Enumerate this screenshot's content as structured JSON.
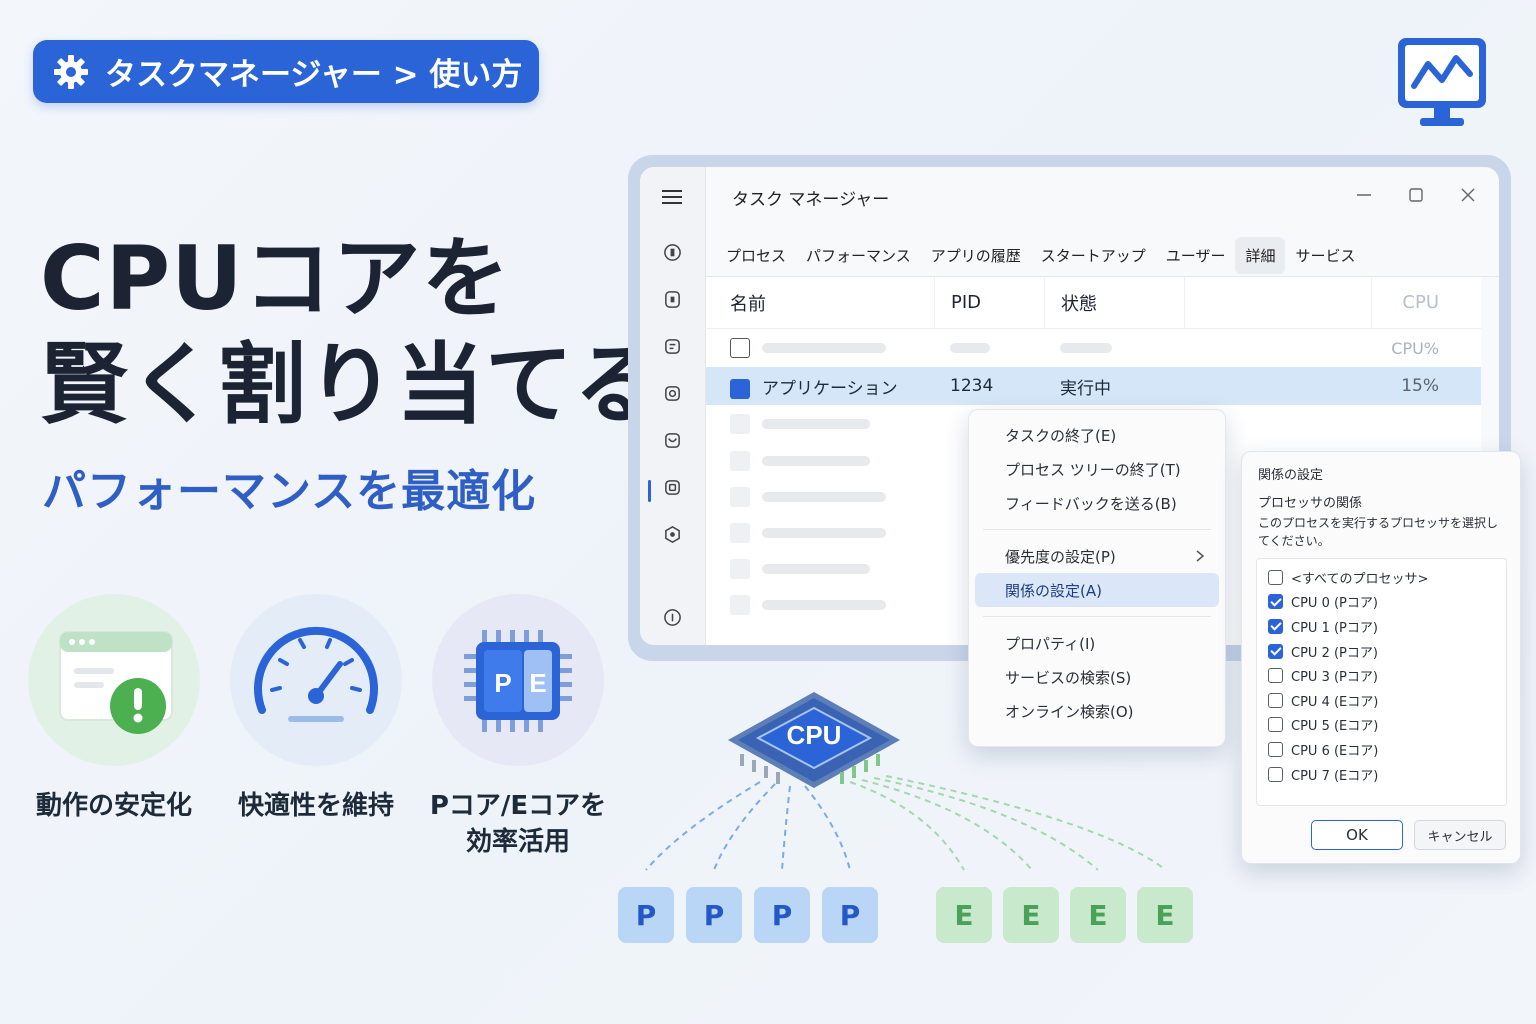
{
  "breadcrumb": {
    "text": "タスクマネージャー > 使い方",
    "icon": "gear-icon"
  },
  "logo": {
    "icon": "monitor-activity-icon",
    "color": "#2a64d6"
  },
  "hero": {
    "title_line1": "CPUコアを",
    "title_line2": "賢く割り当てる",
    "subtitle": "パフォーマンスを最適化"
  },
  "features": [
    {
      "icon": "warning-window-icon",
      "label": "動作の安定化",
      "label2": ""
    },
    {
      "icon": "speedometer-icon",
      "label": "快適性を維持",
      "label2": ""
    },
    {
      "icon": "pe-core-chip-icon",
      "label": "Pコア/Eコアを",
      "label2": "効率活用"
    }
  ],
  "task_manager": {
    "title": "タスク マネージャー",
    "tabs": [
      "プロセス",
      "パフォーマンス",
      "アプリの履歴",
      "スタートアップ",
      "ユーザー",
      "詳細",
      "サービス"
    ],
    "active_tab": "詳細",
    "columns": {
      "name": "名前",
      "pid": "PID",
      "status": "状態",
      "cpu": "CPU"
    },
    "row_top_cpu": "CPU%",
    "selected_row": {
      "name": "アプリケーション",
      "pid": "1234",
      "status": "実行中",
      "cpu": "15%"
    }
  },
  "context_menu": {
    "items": [
      "タスクの終了(E)",
      "プロセス ツリーの終了(T)",
      "フィードバックを送る(B)",
      "優先度の設定(P)",
      "関係の設定(A)",
      "プロパティ(I)",
      "サービスの検索(S)",
      "オンライン検索(O)"
    ],
    "highlighted": "関係の設定(A)"
  },
  "affinity_dialog": {
    "title": "関係の設定",
    "subtitle": "プロセッサの関係",
    "description": "このプロセスを実行するプロセッサを選択してください。",
    "options": [
      {
        "label": "<すべてのプロセッサ>",
        "checked": false
      },
      {
        "label": "CPU 0 (Pコア)",
        "checked": true
      },
      {
        "label": "CPU 1 (Pコア)",
        "checked": true
      },
      {
        "label": "CPU 2 (Pコア)",
        "checked": true
      },
      {
        "label": "CPU 3 (Pコア)",
        "checked": false
      },
      {
        "label": "CPU 4 (Eコア)",
        "checked": false
      },
      {
        "label": "CPU 5 (Eコア)",
        "checked": false
      },
      {
        "label": "CPU 6 (Eコア)",
        "checked": false
      },
      {
        "label": "CPU 7 (Eコア)",
        "checked": false
      }
    ],
    "ok": "OK",
    "cancel": "キャンセル"
  },
  "cpu_diagram": {
    "chip_label": "CPU",
    "p_cores": [
      "P",
      "P",
      "P",
      "P"
    ],
    "e_cores": [
      "E",
      "E",
      "E",
      "E"
    ],
    "colors": {
      "p": "#2458c4",
      "e": "#4aa25a"
    }
  }
}
